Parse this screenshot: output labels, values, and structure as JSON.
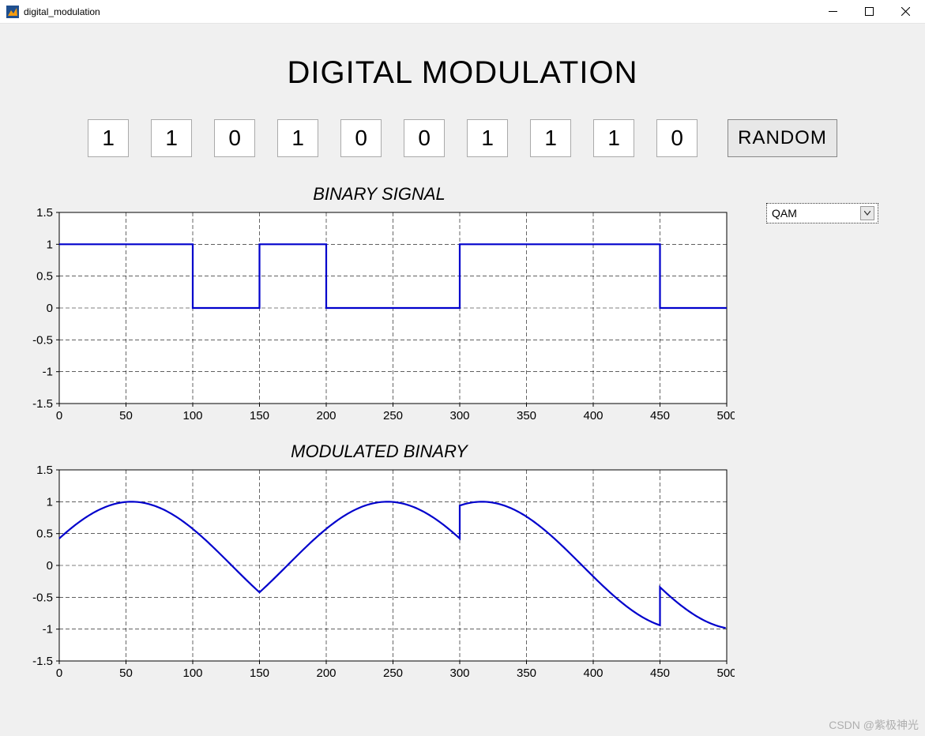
{
  "window": {
    "title": "digital_modulation"
  },
  "main": {
    "title": "DIGITAL MODULATION",
    "bits": [
      "1",
      "1",
      "0",
      "1",
      "0",
      "0",
      "1",
      "1",
      "1",
      "0"
    ],
    "random_label": "RANDOM",
    "dropdown_value": "QAM"
  },
  "watermark": "CSDN @紫极神光",
  "chart_data": [
    {
      "type": "line",
      "title": "BINARY SIGNAL",
      "xlabel": "",
      "ylabel": "",
      "xlim": [
        0,
        500
      ],
      "ylim": [
        -1.5,
        1.5
      ],
      "xticks": [
        0,
        50,
        100,
        150,
        200,
        250,
        300,
        350,
        400,
        450,
        500
      ],
      "yticks": [
        -1.5,
        -1,
        -0.5,
        0,
        0.5,
        1,
        1.5
      ],
      "grid": true,
      "series": [
        {
          "name": "binary",
          "color": "#0000cc",
          "segments": [
            {
              "x": [
                0,
                100
              ],
              "y": 1
            },
            {
              "x": [
                100,
                150
              ],
              "y": 0
            },
            {
              "x": [
                150,
                200
              ],
              "y": 1
            },
            {
              "x": [
                200,
                300
              ],
              "y": 0
            },
            {
              "x": [
                300,
                450
              ],
              "y": 1
            },
            {
              "x": [
                450,
                500
              ],
              "y": 0
            }
          ]
        }
      ]
    },
    {
      "type": "line",
      "title": "MODULATED BINARY",
      "xlabel": "",
      "ylabel": "",
      "xlim": [
        0,
        500
      ],
      "ylim": [
        -1.5,
        1.5
      ],
      "xticks": [
        0,
        50,
        100,
        150,
        200,
        250,
        300,
        350,
        400,
        450,
        500
      ],
      "yticks": [
        -1.5,
        -1,
        -0.5,
        0,
        0.5,
        1,
        1.5
      ],
      "grid": true,
      "series": [
        {
          "name": "modulated",
          "color": "#0000cc",
          "qam_segments": [
            {
              "x0": 0,
              "phase_deg": 25,
              "period": 300
            },
            {
              "x0": 150,
              "phase_deg": -25,
              "period": 300
            },
            {
              "x0": 300,
              "phase_deg": 70,
              "period": 300
            },
            {
              "x0": 450,
              "phase_deg": 200,
              "period": 300
            }
          ]
        }
      ]
    }
  ]
}
